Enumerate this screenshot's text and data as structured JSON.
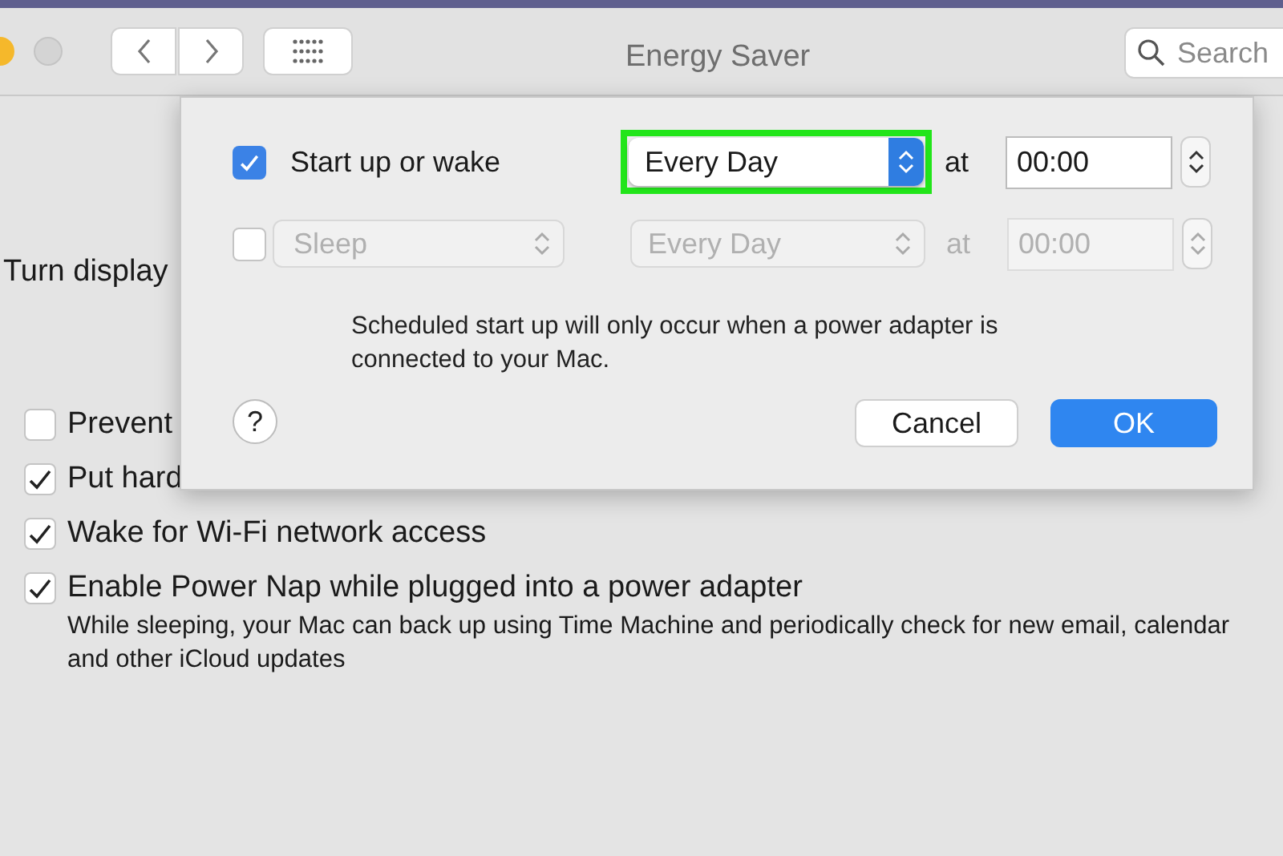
{
  "window": {
    "title": "Energy Saver"
  },
  "toolbar": {
    "search": {
      "placeholder": "Search"
    }
  },
  "background": {
    "turn_display_label": "Turn display",
    "options": [
      {
        "label": "Prevent",
        "checked": false
      },
      {
        "label": "Put hard",
        "checked": true
      },
      {
        "label": "Wake for Wi-Fi network access",
        "checked": true
      },
      {
        "label": "Enable Power Nap while plugged into a power adapter",
        "checked": true,
        "description": "While sleeping, your Mac can back up using Time Machine and periodically check for new email, calendar and other iCloud updates"
      }
    ]
  },
  "schedule_sheet": {
    "rows": [
      {
        "checked": true,
        "disabled": false,
        "event": {
          "kind": "label",
          "text": "Start up or wake"
        },
        "frequency": {
          "value": "Every Day",
          "highlighted": true
        },
        "at_label": "at",
        "time": "00:00"
      },
      {
        "checked": false,
        "disabled": true,
        "event": {
          "kind": "popup",
          "text": "Sleep"
        },
        "frequency": {
          "value": "Every Day",
          "highlighted": false
        },
        "at_label": "at",
        "time": "00:00"
      }
    ],
    "note": "Scheduled start up will only occur when a power adapter is connected to your Mac.",
    "help_button": "?",
    "buttons": [
      {
        "label": "Cancel",
        "kind": "secondary"
      },
      {
        "label": "OK",
        "kind": "primary"
      }
    ]
  }
}
